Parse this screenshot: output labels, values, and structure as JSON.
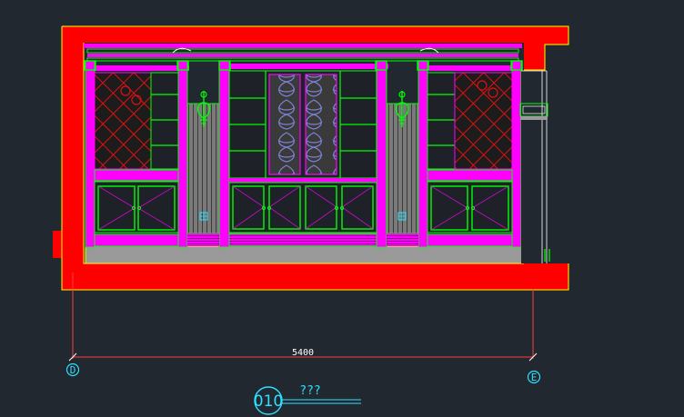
{
  "drawing": {
    "dimension_label": "5400",
    "axis_left": "D",
    "axis_right": "E",
    "view_number": "010",
    "view_title": "???"
  },
  "colors": {
    "background": "#212830",
    "wall": "#ff0000",
    "outline": "#ffff00",
    "frame": "#ff00ff",
    "line": "#00ff00",
    "floor": "#9a9a9a",
    "glass_pattern": "#7d83d8",
    "annotation": "#2ee0ff",
    "dimension": "#ff3b3b"
  }
}
